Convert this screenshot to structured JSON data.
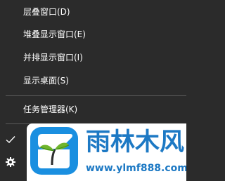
{
  "context_menu": {
    "items": [
      {
        "label": "层叠窗口(D)"
      },
      {
        "label": "堆叠显示窗口(E)"
      },
      {
        "label": "并排显示窗口(I)"
      },
      {
        "label": "显示桌面(S)"
      },
      {
        "label": "任务管理器(K)"
      }
    ],
    "partial_items": [
      {
        "icon": "check-icon"
      },
      {
        "icon": "gear-icon"
      }
    ]
  },
  "watermark": {
    "brand_name": "雨林木风",
    "url": "www.ylmf888.com",
    "colors": {
      "brand": "#1d79c4",
      "logo_bg": "#1a8fe0",
      "logo_leaf": "#6fb52c"
    }
  },
  "colors": {
    "menu_bg": "#2b2b2b",
    "menu_text": "#ffffff",
    "separator": "#5a5a5a"
  }
}
